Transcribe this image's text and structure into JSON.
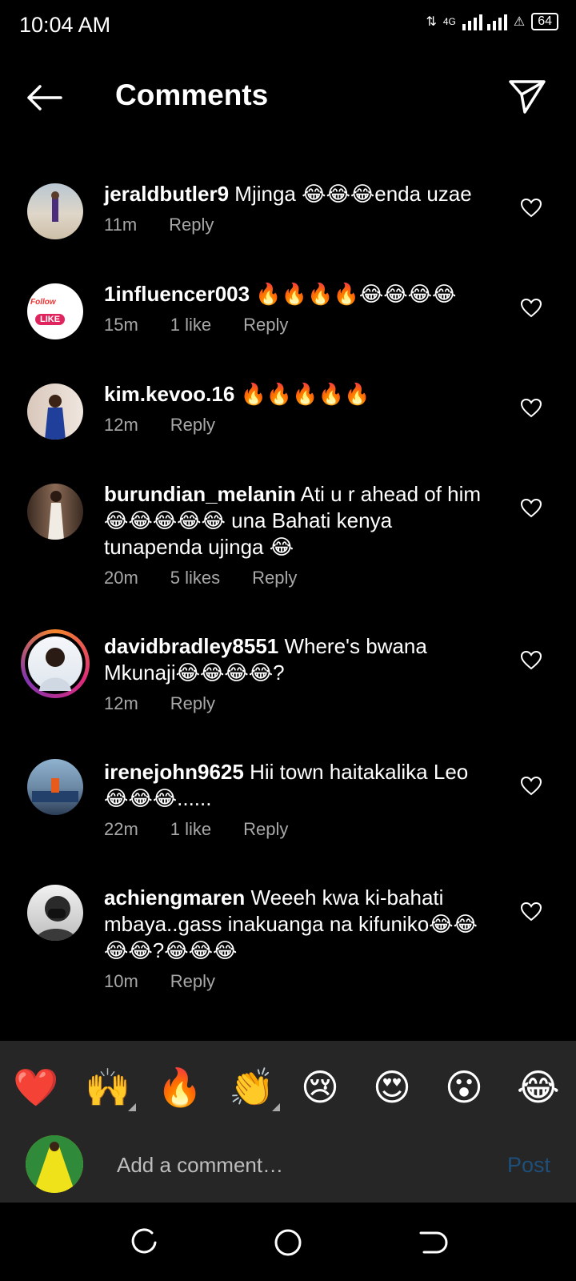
{
  "status": {
    "time": "10:04 AM",
    "network": "4G",
    "battery": "64"
  },
  "header": {
    "title": "Comments"
  },
  "comments": [
    {
      "user": "jeraldbutler9",
      "text": "Mjinga 😂😂😂enda uzae",
      "time": "11m",
      "likes": "",
      "reply": "Reply"
    },
    {
      "user": "1influencer003",
      "text": "🔥🔥🔥🔥😂😂😂😂",
      "time": "15m",
      "likes": "1 like",
      "reply": "Reply"
    },
    {
      "user": "kim.kevoo.16",
      "text": "🔥🔥🔥🔥🔥",
      "time": "12m",
      "likes": "",
      "reply": "Reply"
    },
    {
      "user": "burundian_melanin",
      "text": "Ati u r ahead of him😂😂😂😂😂 una Bahati kenya tunapenda ujinga 😂",
      "time": "20m",
      "likes": "5 likes",
      "reply": "Reply"
    },
    {
      "user": "davidbradley8551",
      "text": "Where's bwana Mkunaji😂😂😂😂?",
      "time": "12m",
      "likes": "",
      "reply": "Reply"
    },
    {
      "user": "irenejohn9625",
      "text": "Hii town haitakalika Leo 😂😂😂......",
      "time": "22m",
      "likes": "1 like",
      "reply": "Reply"
    },
    {
      "user": "achiengmaren",
      "text": "Weeeh kwa ki-bahati mbaya..gass inakuanga na kifuniko😂😂😂😂?😂😂😂",
      "time": "10m",
      "likes": "",
      "reply": "Reply"
    }
  ],
  "avatar_badge": {
    "line1": "Follow",
    "line2": "LIKE"
  },
  "reactions": [
    "❤️",
    "🙌",
    "🔥",
    "👏",
    "😢",
    "😍",
    "😮",
    "😂"
  ],
  "composer": {
    "placeholder": "Add a comment…",
    "post_label": "Post"
  },
  "icons": {
    "back": "arrow-left-icon",
    "send": "paper-plane-icon",
    "like": "heart-outline-icon"
  },
  "colors": {
    "post_disabled": "#1d4f7a",
    "meta_text": "#a8a8a8",
    "panel_bg": "#262626"
  }
}
